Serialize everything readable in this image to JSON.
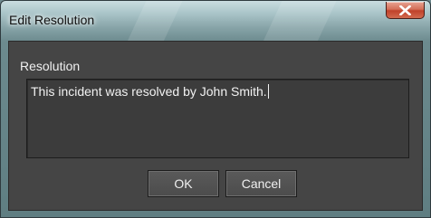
{
  "window": {
    "title": "Edit Resolution",
    "close_icon": "close-icon"
  },
  "resolution": {
    "label": "Resolution",
    "value": "This incident was resolved by John Smith."
  },
  "buttons": {
    "ok_label": "OK",
    "cancel_label": "Cancel"
  },
  "colors": {
    "dialog_background": "#454545",
    "close_button": "#c0412a"
  }
}
